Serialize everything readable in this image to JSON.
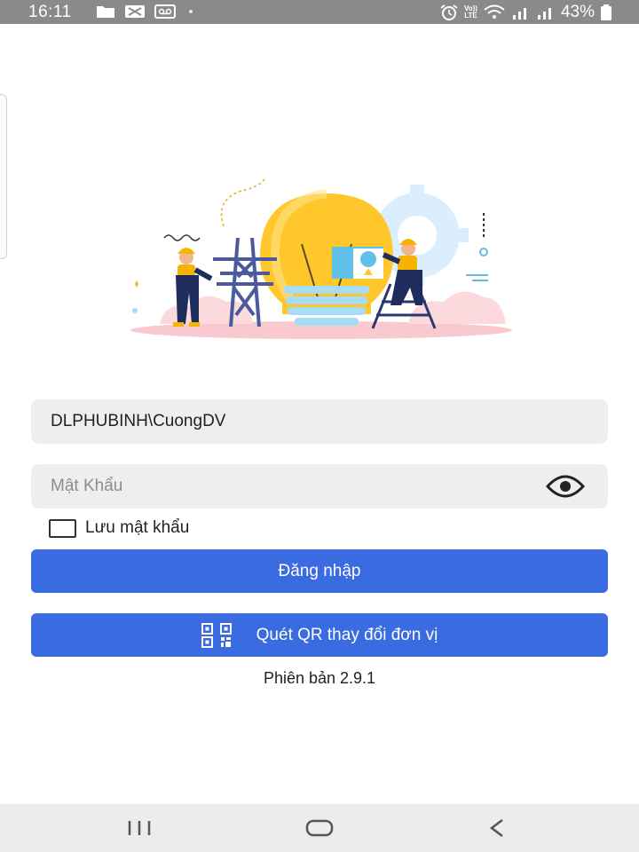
{
  "status_bar": {
    "time": "16:11",
    "battery_percent": "43%",
    "network_label_top": "Vo))",
    "network_label_bottom": "LTE",
    "icons": [
      "folder-icon",
      "tape-icon",
      "voicemail-icon",
      "dot-icon",
      "alarm-icon",
      "wifi-icon",
      "signal-icon",
      "signal-icon",
      "battery-icon"
    ]
  },
  "login": {
    "username_value": "DLPHUBINH\\CuongDV",
    "password_placeholder": "Mật Khẩu",
    "remember_label": "Lưu mật khẩu",
    "remember_checked": false,
    "login_button": "Đăng nhập",
    "qr_button": "Quét QR thay đổi đơn vị",
    "version": "Phiên bản 2.9.1"
  },
  "colors": {
    "primary": "#3a6be0",
    "field_bg": "#eeeeee",
    "status_bar_bg": "#8a8a8a",
    "nav_bar_bg": "#ececec",
    "bulb_yellow": "#ffc72c",
    "worker_navy": "#1f2d5c"
  },
  "illustration": {
    "icon": "electricians-lightbulb-illustration"
  },
  "nav": {
    "items": [
      "recents-icon",
      "home-icon",
      "back-icon"
    ]
  }
}
